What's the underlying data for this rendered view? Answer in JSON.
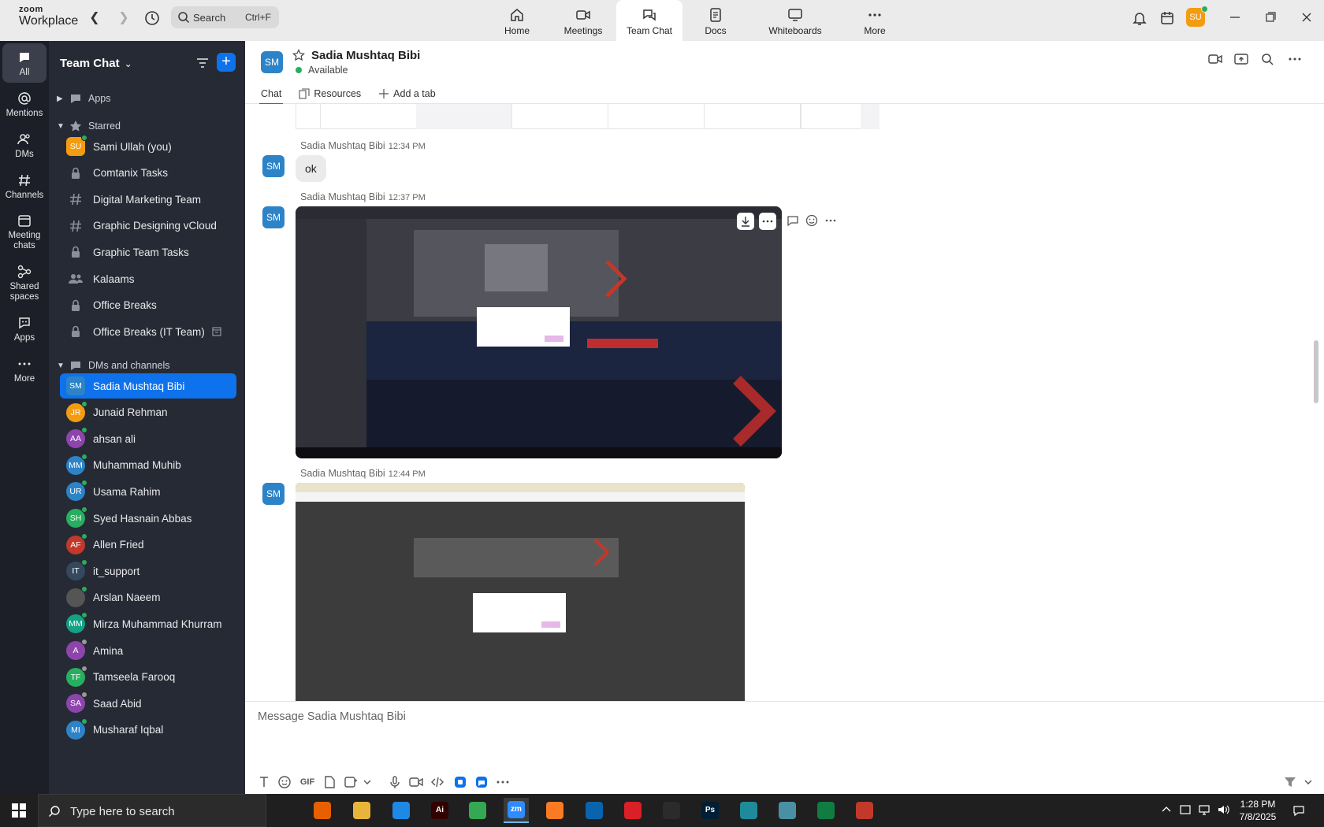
{
  "app": {
    "brand_small": "zoom",
    "brand_large": "Workplace",
    "search_label": "Search",
    "search_shortcut": "Ctrl+F"
  },
  "top_tabs": [
    {
      "label": "Home",
      "icon": "home-icon"
    },
    {
      "label": "Meetings",
      "icon": "video-icon"
    },
    {
      "label": "Team Chat",
      "icon": "chat-icon",
      "active": true
    },
    {
      "label": "Docs",
      "icon": "docs-icon"
    },
    {
      "label": "Whiteboards",
      "icon": "whiteboard-icon"
    },
    {
      "label": "More",
      "icon": "more-icon"
    }
  ],
  "user_avatar": "SU",
  "rail": [
    {
      "label": "All",
      "icon": "chat-bubble-icon",
      "active": true
    },
    {
      "label": "Mentions",
      "icon": "at-icon"
    },
    {
      "label": "DMs",
      "icon": "people-icon"
    },
    {
      "label": "Channels",
      "icon": "hash-icon"
    },
    {
      "label": "Meeting chats",
      "icon": "calendar-icon"
    },
    {
      "label": "Shared spaces",
      "icon": "shared-spaces-icon"
    },
    {
      "label": "Apps",
      "icon": "apps-icon"
    },
    {
      "label": "More",
      "icon": "more-icon"
    }
  ],
  "sidebar": {
    "title": "Team Chat",
    "sections": {
      "apps": "Apps",
      "starred": "Starred",
      "dms": "DMs and channels"
    },
    "starred": [
      {
        "label": "Sami Ullah (you)",
        "type": "avatar",
        "initials": "SU",
        "color": "#f39c12",
        "presence": "#27ae60"
      },
      {
        "label": "Comtanix Tasks",
        "type": "lock"
      },
      {
        "label": "Digital Marketing Team",
        "type": "hash"
      },
      {
        "label": "Graphic Designing vCloud",
        "type": "hash"
      },
      {
        "label": "Graphic Team Tasks",
        "type": "lock"
      },
      {
        "label": "Kalaams",
        "type": "group"
      },
      {
        "label": "Office Breaks",
        "type": "lock"
      },
      {
        "label": "Office Breaks (IT Team)",
        "type": "lock",
        "extra": "archive-icon"
      }
    ],
    "dms": [
      {
        "label": "Sadia Mushtaq Bibi",
        "initials": "SM",
        "color": "#2d83c7",
        "active": true
      },
      {
        "label": "Junaid Rehman",
        "initials": "JR",
        "color": "#f39c12",
        "presence": "#27ae60"
      },
      {
        "label": "ahsan ali",
        "initials": "AA",
        "color": "#8e44ad",
        "presence": "#27ae60"
      },
      {
        "label": "Muhammad Muhib",
        "initials": "MM",
        "color": "#2d83c7",
        "presence": "#27ae60"
      },
      {
        "label": "Usama Rahim",
        "initials": "UR",
        "color": "#2d83c7",
        "presence": "#27ae60"
      },
      {
        "label": "Syed Hasnain Abbas",
        "initials": "SH",
        "color": "#27ae60",
        "presence": "#27ae60"
      },
      {
        "label": "Allen Fried",
        "initials": "AF",
        "color": "#c0392b",
        "presence": "#27ae60"
      },
      {
        "label": "it_support",
        "initials": "IT",
        "color": "#34495e",
        "presence": "#27ae60"
      },
      {
        "label": "Arslan Naeem",
        "initials": "",
        "color": "#555555",
        "presence": "#27ae60"
      },
      {
        "label": "Mirza Muhammad Khurram",
        "initials": "MM",
        "color": "#16a085",
        "presence": "#27ae60"
      },
      {
        "label": "Amina",
        "initials": "A",
        "color": "#8e44ad",
        "presence": "#999999"
      },
      {
        "label": "Tamseela Farooq",
        "initials": "TF",
        "color": "#27ae60",
        "presence": "#999999"
      },
      {
        "label": "Saad Abid",
        "initials": "SA",
        "color": "#8e44ad",
        "presence": "#999999"
      },
      {
        "label": "Musharaf Iqbal",
        "initials": "MI",
        "color": "#2d83c7",
        "presence": "#27ae60"
      }
    ]
  },
  "chat": {
    "contact_initials": "SM",
    "contact_name": "Sadia Mushtaq Bibi",
    "status": "Available",
    "tabs": [
      "Chat",
      "Resources",
      "Add a tab"
    ],
    "messages": [
      {
        "sender": "Sadia Mushtaq Bibi",
        "time": "12:34 PM",
        "text": "ok"
      },
      {
        "sender": "Sadia Mushtaq Bibi",
        "time": "12:37 PM",
        "attachment": "screenshot"
      },
      {
        "sender": "Sadia Mushtaq Bibi",
        "time": "12:44 PM",
        "attachment": "screenshot"
      }
    ],
    "composer_placeholder": "Message Sadia Mushtaq Bibi",
    "gif_label": "GIF"
  },
  "taskbar": {
    "search_text": "Type here to search",
    "time": "1:28 PM",
    "date": "7/8/2025",
    "apps": [
      {
        "name": "task-view-icon",
        "color": "#1f1f1f",
        "label": ""
      },
      {
        "name": "firefox-icon",
        "color": "#e66000",
        "label": ""
      },
      {
        "name": "file-explorer-icon",
        "color": "#e8b53a",
        "label": ""
      },
      {
        "name": "vscode-icon",
        "color": "#1e88e5",
        "label": ""
      },
      {
        "name": "illustrator-icon",
        "color": "#330000",
        "label": "Ai"
      },
      {
        "name": "chrome-icon",
        "color": "#34a853",
        "label": ""
      },
      {
        "name": "zoom-icon",
        "color": "#2d8cff",
        "label": "zm"
      },
      {
        "name": "xampp-icon",
        "color": "#fb7a24",
        "label": ""
      },
      {
        "name": "outlook-icon",
        "color": "#0a64ad",
        "label": ""
      },
      {
        "name": "creative-cloud-icon",
        "color": "#da1f26",
        "label": ""
      },
      {
        "name": "inkscape-icon",
        "color": "#2b2b2b",
        "label": ""
      },
      {
        "name": "photoshop-icon",
        "color": "#001e36",
        "label": "Ps"
      },
      {
        "name": "app-diamond-icon",
        "color": "#1f8a9a",
        "label": ""
      },
      {
        "name": "app-card-icon",
        "color": "#4a90a4",
        "label": ""
      },
      {
        "name": "excel-icon",
        "color": "#107c41",
        "label": ""
      },
      {
        "name": "snipping-icon",
        "color": "#c0392b",
        "label": ""
      }
    ]
  },
  "colors": {
    "accent": "#0e72ed",
    "rail_bg": "#1c1f28",
    "sidebar_bg": "#262a34",
    "topbar_bg": "#ebebeb"
  }
}
